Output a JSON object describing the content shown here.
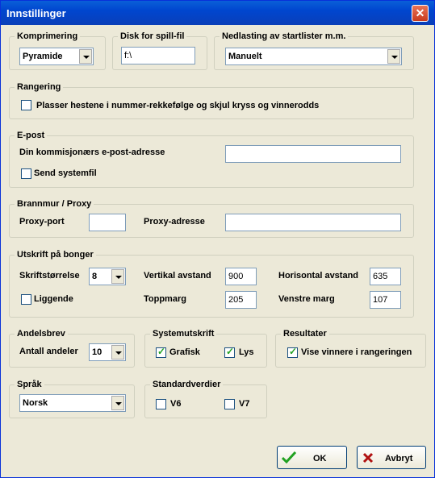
{
  "window": {
    "title": "Innstillinger",
    "close_glyph": "✕"
  },
  "komprimering": {
    "label": "Komprimering",
    "value": "Pyramide"
  },
  "disk": {
    "label": "Disk for spill-fil",
    "value": "f:\\"
  },
  "nedlasting": {
    "label": "Nedlasting av startlister m.m.",
    "value": "Manuelt"
  },
  "rangering": {
    "label": "Rangering",
    "option_label": "Plasser hestene i nummer-rekkefølge og skjul kryss og vinnerodds",
    "checked": false
  },
  "epost": {
    "label": "E-post",
    "address_label": "Din kommisjonærs e-post-adresse",
    "address_value": "",
    "send_label": "Send systemfil",
    "send_checked": false
  },
  "brannmur": {
    "label": "Brannmur / Proxy",
    "port_label": "Proxy-port",
    "port_value": "",
    "address_label": "Proxy-adresse",
    "address_value": ""
  },
  "utskrift": {
    "label": "Utskrift på bonger",
    "skrift_label": "Skriftstørrelse",
    "skrift_value": "8",
    "vertikal_label": "Vertikal avstand",
    "vertikal_value": "900",
    "horisontal_label": "Horisontal avstand",
    "horisontal_value": "635",
    "liggende_label": "Liggende",
    "liggende_checked": false,
    "topp_label": "Toppmarg",
    "topp_value": "205",
    "venstre_label": "Venstre marg",
    "venstre_value": "107"
  },
  "andelsbrev": {
    "label": "Andelsbrev",
    "antall_label": "Antall andeler",
    "antall_value": "10"
  },
  "systemutskrift": {
    "label": "Systemutskrift",
    "grafisk_label": "Grafisk",
    "grafisk_checked": true,
    "lys_label": "Lys",
    "lys_checked": true
  },
  "resultater": {
    "label": "Resultater",
    "vise_label": "Vise vinnere i rangeringen",
    "vise_checked": true
  },
  "sprak": {
    "label": "Språk",
    "value": "Norsk"
  },
  "standardverdier": {
    "label": "Standardverdier",
    "v6_label": "V6",
    "v6_checked": false,
    "v7_label": "V7",
    "v7_checked": false
  },
  "buttons": {
    "ok_label": "OK",
    "ok_icon": "check-icon",
    "cancel_label": "Avbryt",
    "cancel_icon": "cross-icon"
  },
  "check_glyph": "✓",
  "colors": {
    "title_bar": "#0046cf",
    "dialog_bg": "#ece9d8",
    "close_button": "#d4532f",
    "ok_check": "#21a121",
    "cancel_cross": "#b01010"
  }
}
